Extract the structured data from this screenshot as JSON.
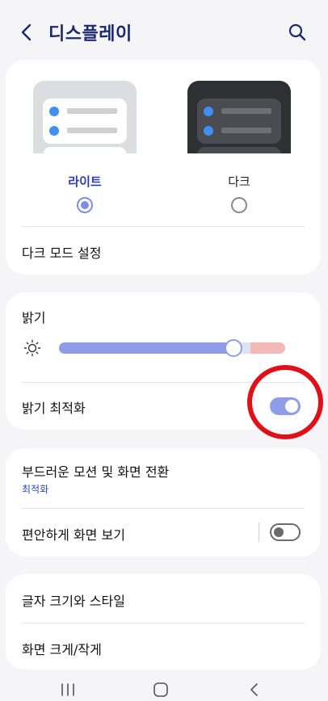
{
  "header": {
    "title": "디스플레이",
    "back_icon": "chevron-left-icon",
    "search_icon": "search-icon"
  },
  "theme": {
    "light_label": "라이트",
    "dark_label": "다크",
    "selected": "light",
    "dark_mode_settings": "다크 모드 설정"
  },
  "brightness": {
    "label": "밝기",
    "level": 0.77,
    "adaptive_label": "밝기 최적화",
    "adaptive_on": true
  },
  "motion": {
    "label": "부드러운 모션 및 화면 전환",
    "sub": "최적화",
    "eye_comfort_label": "편안하게 화면 보기",
    "eye_comfort_on": false
  },
  "text": {
    "font_label": "글자 크기와 스타일",
    "zoom_label": "화면 크게/작게"
  },
  "navbar": {
    "recent_icon": "recent-apps-icon",
    "home_icon": "home-icon",
    "back_icon": "back-icon"
  },
  "colors": {
    "accent": "#8f9de9",
    "title": "#1a2a6c",
    "annotation": "#e0101a"
  }
}
